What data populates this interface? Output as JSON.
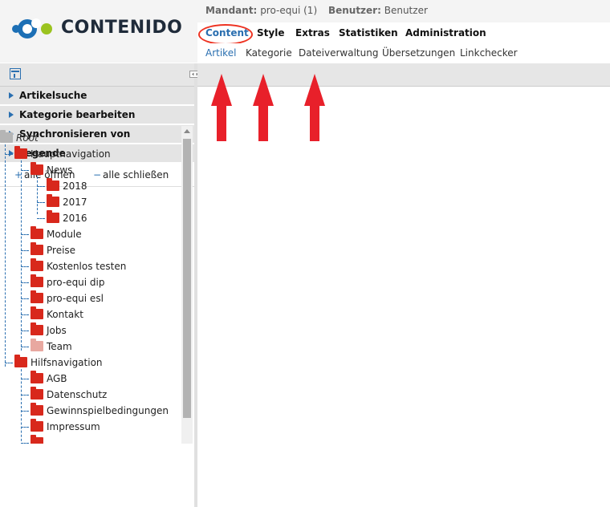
{
  "header": {
    "logo_text": "CONTENIDO",
    "mandant_label": "Mandant:",
    "mandant_value": "pro-equi (1)",
    "benutzer_label": "Benutzer:",
    "benutzer_value": "Benutzer"
  },
  "main_nav": [
    "Content",
    "Style",
    "Extras",
    "Statistiken",
    "Administration"
  ],
  "sub_nav": [
    "Artikel",
    "Kategorie",
    "Dateiverwaltung",
    "Übersetzungen",
    "Linkchecker"
  ],
  "sections": [
    "Artikelsuche",
    "Kategorie bearbeiten",
    "Synchronisieren von",
    "Legende"
  ],
  "tree_controls": {
    "open_symbol": "+",
    "open_label": "alle öffnen",
    "close_symbol": "−",
    "close_label": "alle schließen"
  },
  "tree": [
    {
      "label": "Root",
      "depth": 0,
      "folder": "grey"
    },
    {
      "label": "Hauptnavigation",
      "depth": 1,
      "folder": "red"
    },
    {
      "label": "News",
      "depth": 2,
      "folder": "red"
    },
    {
      "label": "2018",
      "depth": 3,
      "folder": "red"
    },
    {
      "label": "2017",
      "depth": 3,
      "folder": "red"
    },
    {
      "label": "2016",
      "depth": 3,
      "folder": "red"
    },
    {
      "label": "Module",
      "depth": 2,
      "folder": "red"
    },
    {
      "label": "Preise",
      "depth": 2,
      "folder": "red"
    },
    {
      "label": "Kostenlos testen",
      "depth": 2,
      "folder": "red"
    },
    {
      "label": "pro-equi dip",
      "depth": 2,
      "folder": "red"
    },
    {
      "label": "pro-equi esl",
      "depth": 2,
      "folder": "red"
    },
    {
      "label": "Kontakt",
      "depth": 2,
      "folder": "red"
    },
    {
      "label": "Jobs",
      "depth": 2,
      "folder": "red"
    },
    {
      "label": "Team",
      "depth": 2,
      "folder": "pink"
    },
    {
      "label": "Hilfsnavigation",
      "depth": 1,
      "folder": "red"
    },
    {
      "label": "AGB",
      "depth": 2,
      "folder": "red"
    },
    {
      "label": "Datenschutz",
      "depth": 2,
      "folder": "red"
    },
    {
      "label": "Gewinnspielbedingungen",
      "depth": 2,
      "folder": "red"
    },
    {
      "label": "Impressum",
      "depth": 2,
      "folder": "red"
    },
    {
      "label": "",
      "depth": 2,
      "folder": "red"
    }
  ],
  "colors": {
    "accent": "#2a6fb0",
    "folder": "#d8281c",
    "annotation_red": "#e8202a"
  }
}
